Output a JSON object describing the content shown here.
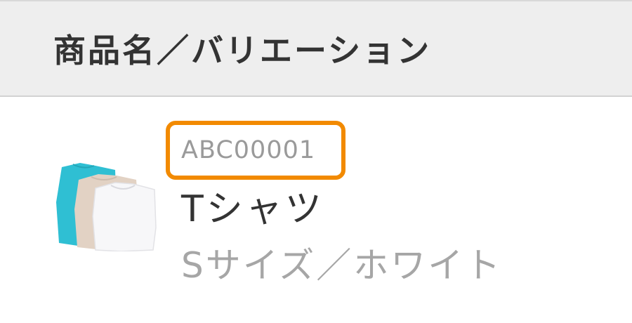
{
  "table": {
    "header_label": "商品名／バリエーション"
  },
  "product": {
    "sku": "ABC00001",
    "name": "Tシャツ",
    "variation": "Sサイズ／ホワイト",
    "image_icon": "tshirt-stack-thumbnail",
    "highlight_color": "#f28a00"
  }
}
